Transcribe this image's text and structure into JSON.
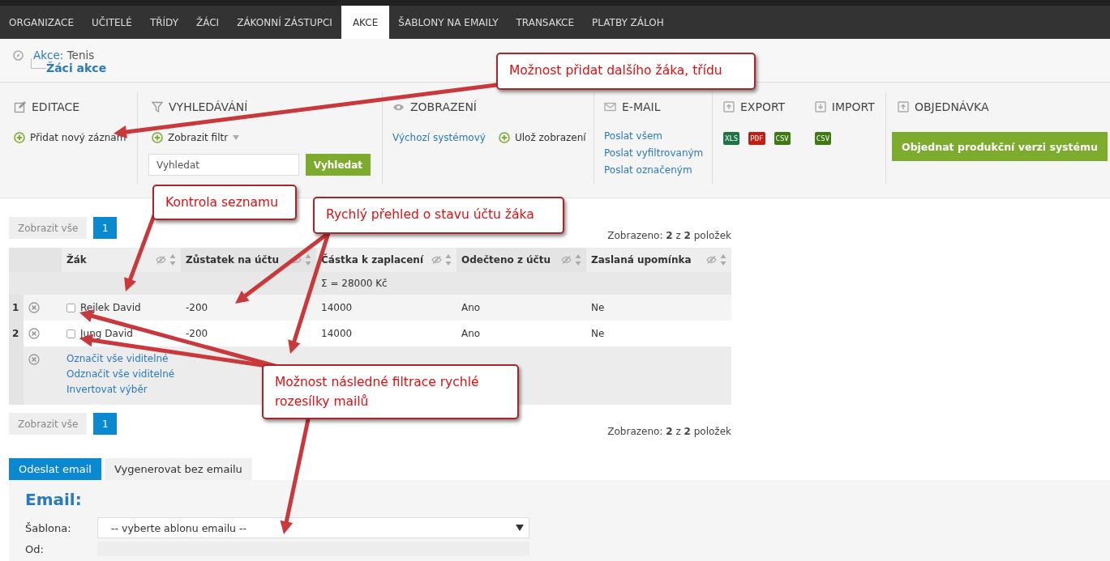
{
  "nav": {
    "tabs": [
      {
        "label": "ORGANIZACE",
        "selected": false
      },
      {
        "label": "UČITELÉ",
        "selected": false
      },
      {
        "label": "TŘÍDY",
        "selected": false
      },
      {
        "label": "ŽÁCI",
        "selected": false
      },
      {
        "label": "ZÁKONNÍ ZÁSTUPCI",
        "selected": false
      },
      {
        "label": "AKCE",
        "selected": true
      },
      {
        "label": "ŠABLONY NA EMAILY",
        "selected": false
      },
      {
        "label": "TRANSAKCE",
        "selected": false
      },
      {
        "label": "PLATBY ZÁLOH",
        "selected": false
      }
    ]
  },
  "breadcrumb": {
    "parent_label": "Akce:",
    "parent_value": "Tenis",
    "current": "Žáci akce"
  },
  "toolbar": {
    "editing": {
      "title": "EDITACE",
      "add_action": "Přidat nový záznam"
    },
    "search": {
      "title": "VYHLEDÁVÁNÍ",
      "filter_action": "Zobrazit filtr",
      "placeholder": "Vyhledat",
      "button": "Vyhledat"
    },
    "view": {
      "title": "ZOBRAZENÍ",
      "default_link": "Výchozí systémový",
      "save_action": "Ulož zobrazení"
    },
    "email": {
      "title": "E-MAIL",
      "links": [
        "Poslat všem",
        "Poslat vyfiltrovaným",
        "Poslat označeným"
      ]
    },
    "export": {
      "title": "EXPORT",
      "formats": [
        {
          "label": "XLS",
          "color": "#217346"
        },
        {
          "label": "PDF",
          "color": "#c41e12"
        },
        {
          "label": "CSV",
          "color": "#3d7a12"
        }
      ]
    },
    "import": {
      "title": "IMPORT",
      "formats": [
        {
          "label": "CSV",
          "color": "#3d7a12"
        }
      ]
    },
    "order": {
      "title": "OBJEDNÁVKA",
      "button": "Objednat produkční verzi systému"
    }
  },
  "pager_top": {
    "show_all": "Zobrazit vše",
    "pages": [
      {
        "label": "1",
        "selected": true
      }
    ],
    "summary": "Zobrazeno: **2** z **2** položek"
  },
  "table": {
    "columns": [
      "Žák",
      "Zůstatek na účtu",
      "Částka k zaplacení",
      "Odečteno z účtu",
      "Zaslaná upomínka"
    ],
    "sum": "Σ = 28000 Kč",
    "rows": [
      {
        "number": "1",
        "checked": false,
        "cells": [
          "Rejlek David",
          "-200",
          "14000",
          "Ano",
          "Ne"
        ]
      },
      {
        "number": "2",
        "checked": false,
        "cells": [
          "Jung David",
          "-200",
          "14000",
          "Ano",
          "Ne"
        ]
      }
    ],
    "footer_links": [
      "Označit vše viditelné",
      "Odznačit vše viditelné",
      "Invertovat výběr"
    ]
  },
  "pager_bottom": {
    "show_all": "Zobrazit vše",
    "pages": [
      {
        "label": "1",
        "selected": true
      }
    ],
    "summary": "Zobrazeno: **2** z **2** položek"
  },
  "email_tabs": [
    {
      "label": "Odeslat email",
      "selected": true
    },
    {
      "label": "Vygenerovat bez emailu",
      "selected": false
    }
  ],
  "email_form": {
    "heading": "Email:",
    "template_label": "Šablona:",
    "template_value": "-- vyberte ablonu emailu --",
    "from_label": "Od:"
  },
  "annotations": [
    {
      "text": "Možnost přidat dalšího žáka, třídu"
    },
    {
      "text": "Kontrola seznamu"
    },
    {
      "text": "Rychlý přehled o stavu účtu žáka"
    },
    {
      "text": "Možnost následné filtrace rychlé rozesílky mailů"
    }
  ]
}
